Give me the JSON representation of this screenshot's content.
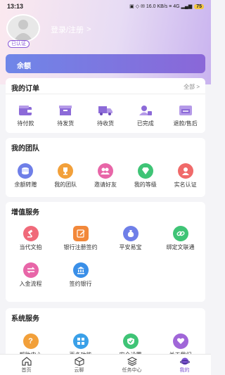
{
  "status": {
    "time": "13:13",
    "icons": "▣ ◇ ✉  16.0 KB/s  ≡ 4G  ▂▄▆",
    "battery": "75"
  },
  "profile": {
    "login_text": "登录/注册",
    "login_arrow": ">",
    "badge": "已认证"
  },
  "balance": {
    "label": "余额"
  },
  "orders": {
    "title": "我的订单",
    "more": "全部",
    "more_arrow": ">",
    "items": [
      {
        "label": "待付款",
        "icon": "wallet-icon"
      },
      {
        "label": "待发货",
        "icon": "box-icon"
      },
      {
        "label": "待收货",
        "icon": "truck-icon"
      },
      {
        "label": "已完成",
        "icon": "user-check-icon"
      },
      {
        "label": "退款/售后",
        "icon": "refund-icon"
      }
    ]
  },
  "team": {
    "title": "我的团队",
    "items": [
      {
        "label": "余额转赠",
        "icon": "coins-icon",
        "color": "#6f7fe8"
      },
      {
        "label": "我的团队",
        "icon": "trophy-icon",
        "color": "#f2a03a"
      },
      {
        "label": "邀请好友",
        "icon": "people-icon",
        "color": "#e866a8"
      },
      {
        "label": "我的等级",
        "icon": "diamond-icon",
        "color": "#3fc476"
      },
      {
        "label": "实名认证",
        "icon": "id-person-icon",
        "color": "#f06a6a"
      }
    ]
  },
  "value_services": {
    "title": "增值服务",
    "items": [
      {
        "label": "当代文拍",
        "icon": "gavel-icon",
        "color": "#f06a7a"
      },
      {
        "label": "银行注册签约",
        "icon": "edit-icon",
        "color": "#f2883a"
      },
      {
        "label": "平安易宝",
        "icon": "moneybag-icon",
        "color": "#6f7fe8"
      },
      {
        "label": "绑定文联通",
        "icon": "link-icon",
        "color": "#3fc476"
      },
      {
        "label": "入金流程",
        "icon": "transfer-icon",
        "color": "#e866a8"
      },
      {
        "label": "签约银行",
        "icon": "bank-icon",
        "color": "#3a8fe8"
      }
    ]
  },
  "system_services": {
    "title": "系统服务",
    "items": [
      {
        "label": "帮助中心",
        "icon": "help-icon",
        "color": "#f2a03a"
      },
      {
        "label": "更多功能",
        "icon": "grid-icon",
        "color": "#3aa0e8"
      },
      {
        "label": "安全设置",
        "icon": "shield-check-icon",
        "color": "#3fc476"
      },
      {
        "label": "关于我们",
        "icon": "heart-chat-icon",
        "color": "#a066d8"
      }
    ]
  },
  "tabbar": {
    "tabs": [
      {
        "label": "首页",
        "icon": "home-icon"
      },
      {
        "label": "云聊",
        "icon": "cube-icon"
      },
      {
        "label": "任务中心",
        "icon": "layers-icon"
      },
      {
        "label": "我的",
        "icon": "planet-icon"
      }
    ]
  }
}
